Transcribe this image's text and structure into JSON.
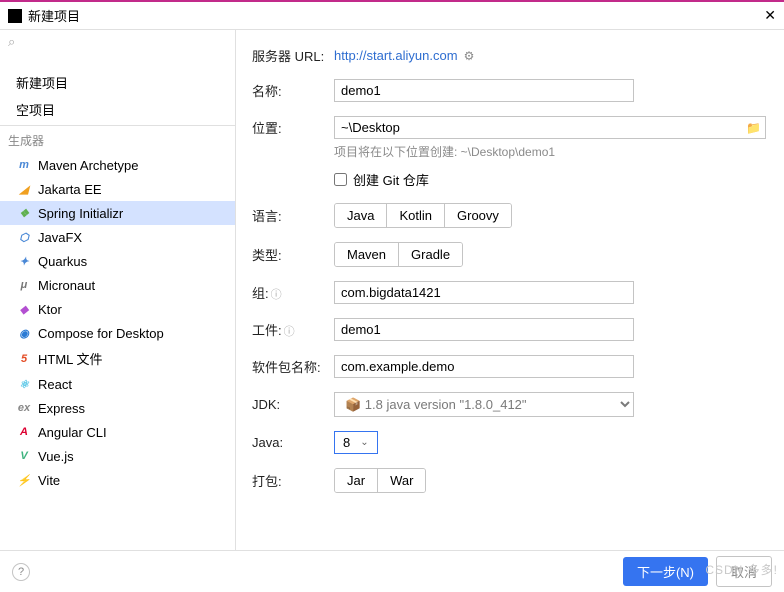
{
  "window": {
    "title": "新建项目"
  },
  "search": {
    "placeholder": ""
  },
  "groups": {
    "top": [
      "新建项目",
      "空项目"
    ],
    "generators_label": "生成器",
    "generators": [
      {
        "label": "Maven Archetype",
        "color": "#4a88d6",
        "glyph": "m"
      },
      {
        "label": "Jakarta EE",
        "color": "#f0a020",
        "glyph": "◢"
      },
      {
        "label": "Spring Initializr",
        "color": "#5fb04f",
        "glyph": "❖",
        "selected": true
      },
      {
        "label": "JavaFX",
        "color": "#4a88d6",
        "glyph": "⬡"
      },
      {
        "label": "Quarkus",
        "color": "#4a88d6",
        "glyph": "✦"
      },
      {
        "label": "Micronaut",
        "color": "#777",
        "glyph": "μ"
      },
      {
        "label": "Ktor",
        "color": "#b34fd1",
        "glyph": "◆"
      },
      {
        "label": "Compose for Desktop",
        "color": "#2a7ad4",
        "glyph": "◉"
      },
      {
        "label": "HTML 文件",
        "color": "#e44d26",
        "glyph": "5"
      },
      {
        "label": "React",
        "color": "#5fc9e8",
        "glyph": "⚛"
      },
      {
        "label": "Express",
        "color": "#888",
        "glyph": "ex"
      },
      {
        "label": "Angular CLI",
        "color": "#dd0031",
        "glyph": "A"
      },
      {
        "label": "Vue.js",
        "color": "#3fb37f",
        "glyph": "V"
      },
      {
        "label": "Vite",
        "color": "#a355f7",
        "glyph": "⚡"
      }
    ]
  },
  "form": {
    "server_label": "服务器 URL:",
    "server_url": "http://start.aliyun.com",
    "name_label": "名称:",
    "name_value": "demo1",
    "location_label": "位置:",
    "location_value": "~\\Desktop",
    "location_hint": "项目将在以下位置创建: ~\\Desktop\\demo1",
    "git_label": "创建 Git 仓库",
    "language_label": "语言:",
    "language_opts": [
      "Java",
      "Kotlin",
      "Groovy"
    ],
    "type_label": "类型:",
    "type_opts": [
      "Maven",
      "Gradle"
    ],
    "group_label": "组:",
    "group_value": "com.bigdata1421",
    "artifact_label": "工件:",
    "artifact_value": "demo1",
    "package_label": "软件包名称:",
    "package_value": "com.example.demo",
    "jdk_label": "JDK:",
    "jdk_value": "1.8 java version \"1.8.0_412\"",
    "java_label": "Java:",
    "java_value": "8",
    "packaging_label": "打包:",
    "packaging_opts": [
      "Jar",
      "War"
    ]
  },
  "footer": {
    "next": "下一步(N)",
    "cancel": "取消"
  },
  "watermark": "CSDN 多多!"
}
